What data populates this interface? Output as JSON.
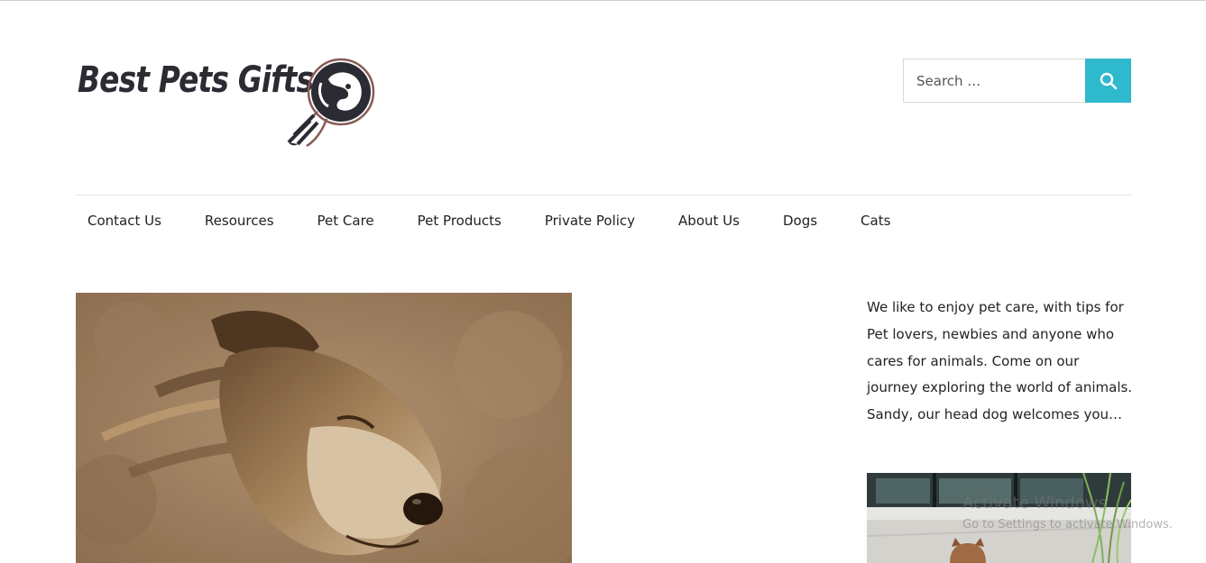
{
  "site": {
    "logo_text": "Best Pets Gifts"
  },
  "search": {
    "placeholder": "Search …",
    "button_icon": "search-icon",
    "accent_color": "#2fb9cc"
  },
  "nav": {
    "items": [
      {
        "label": "Contact Us"
      },
      {
        "label": "Resources"
      },
      {
        "label": "Pet Care"
      },
      {
        "label": "Pet Products"
      },
      {
        "label": "Private Policy"
      },
      {
        "label": "About Us"
      },
      {
        "label": "Dogs"
      },
      {
        "label": "Cats"
      }
    ]
  },
  "sidebar": {
    "about_text": "We like to enjoy pet care, with tips for Pet lovers, newbies and anyone who cares for animals. Come on our journey exploring the world of animals. Sandy, our head dog welcomes you…"
  },
  "watermark": {
    "title": "Activate Windows",
    "subtitle": "Go to Settings to activate Windows."
  }
}
